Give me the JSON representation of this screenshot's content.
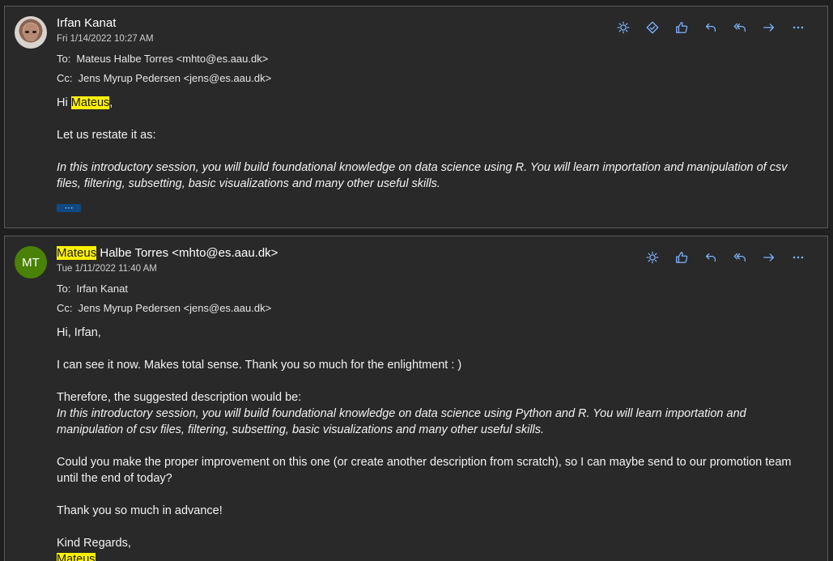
{
  "messages": [
    {
      "sender": "Irfan Kanat",
      "date": "Fri 1/14/2022 10:27 AM",
      "to_label": "To:",
      "to": "Mateus Halbe Torres <mhto@es.aau.dk>",
      "cc_label": "Cc:",
      "cc": "Jens Myrup Pedersen <jens@es.aau.dk>",
      "greeting_prefix": "Hi ",
      "greeting_name": "Mateus",
      "greeting_suffix": ",",
      "line1": "Let us restate it as:",
      "quote": "In this introductory session, you will build foundational knowledge on data science using R. You will learn importation and manipulation of csv files, filtering, subsetting, basic visualizations and many other useful skills.",
      "more_label": "···",
      "toolbar": [
        "sun-icon",
        "tag-icon",
        "like-icon",
        "reply-icon",
        "reply-all-icon",
        "forward-icon",
        "more-icon"
      ]
    },
    {
      "sender_highlight": "Mateus",
      "sender_rest": " Halbe Torres <mhto@es.aau.dk>",
      "initials": "MT",
      "date": "Tue 1/11/2022 11:40 AM",
      "to_label": "To:",
      "to": "Irfan Kanat",
      "cc_label": "Cc:",
      "cc": "Jens Myrup Pedersen <jens@es.aau.dk>",
      "greeting": "Hi, Irfan,",
      "line1": "I can see it now. Makes total sense. Thank you so much for the enlightment : )",
      "line2": "Therefore, the suggested description would be:",
      "quote": "In this introductory session, you will build foundational knowledge on data science using Python and R. You will learn importation and manipulation of csv files, filtering, subsetting, basic visualizations and many other useful skills.",
      "line3": "Could you make the proper improvement on this one (or create another description from scratch), so I can maybe send to our promotion team until the end of today?",
      "line4": "Thank you so much in advance!",
      "closing": "Kind Regards,",
      "signature": "Mateus",
      "toolbar": [
        "sun-icon",
        "like-icon",
        "reply-icon",
        "reply-all-icon",
        "forward-icon",
        "more-icon"
      ]
    }
  ],
  "colors": {
    "accent": "#7fb4ff",
    "highlight": "#fff100",
    "avatar_bg": "#498205",
    "panel": "#292929"
  }
}
